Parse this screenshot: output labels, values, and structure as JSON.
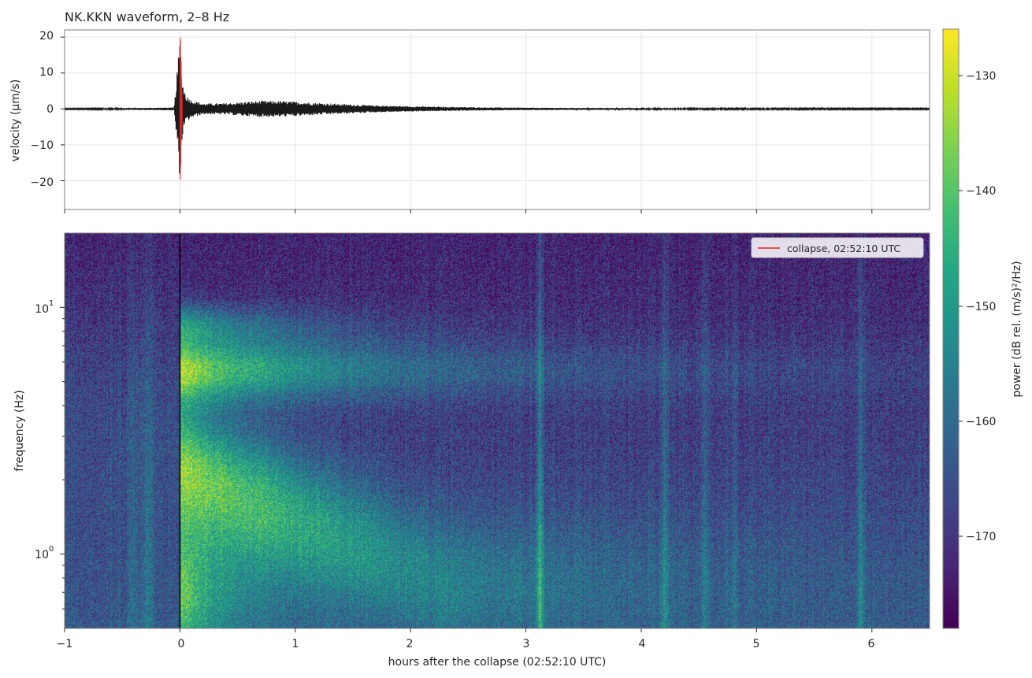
{
  "chart_data": [
    {
      "type": "line",
      "title": "NK.KKN waveform, 2–8 Hz",
      "ylabel": "velocity (µm/s)",
      "xlabel": "",
      "xlim": [
        -1,
        6.5
      ],
      "ylim": [
        -28,
        22
      ],
      "yticks": [
        20,
        10,
        0,
        -10,
        -20
      ],
      "ytick_labels": [
        "20",
        "10",
        "0",
        "−10",
        "−20"
      ],
      "grid": true,
      "series": [
        {
          "name": "",
          "color": "#1a1a1a",
          "envelope_x": [
            -1,
            -0.7,
            -0.3,
            -0.05,
            0.0,
            0.01,
            0.02,
            0.05,
            0.1,
            0.2,
            0.4,
            0.7,
            0.9,
            1.2,
            1.6,
            2.0,
            2.5,
            3.0,
            3.5,
            4.5,
            6.5
          ],
          "envelope_amp": [
            0.15,
            0.2,
            0.3,
            0.4,
            20,
            15,
            8,
            4,
            2.5,
            1.5,
            1.6,
            2.3,
            2.2,
            1.7,
            1.1,
            0.75,
            0.5,
            0.35,
            0.28,
            0.22,
            0.18
          ]
        },
        {
          "name": "",
          "color": "#d62728",
          "envelope_x": [
            0.0,
            0.005,
            0.012,
            0.02
          ],
          "envelope_amp": [
            25,
            19,
            10,
            3
          ]
        }
      ]
    },
    {
      "type": "heatmap",
      "title": "",
      "xlabel": "hours after the collapse (02:52:10 UTC)",
      "ylabel": "frequency (Hz)",
      "xlim": [
        -1,
        6.5
      ],
      "ylim": [
        0.5,
        20
      ],
      "yscale": "log",
      "xticks": [
        -1,
        0,
        1,
        2,
        3,
        4,
        5,
        6
      ],
      "xtick_labels": [
        "−1",
        "0",
        "1",
        "2",
        "3",
        "4",
        "5",
        "6"
      ],
      "yticks": [
        1,
        10
      ],
      "ytick_labels": [
        "10",
        "10"
      ],
      "ytick_exponents": [
        "0",
        "1"
      ],
      "colormap": "viridis",
      "colorbar": {
        "label": "power (dB rel. (m/s)²/Hz)",
        "range": [
          -178,
          -126
        ],
        "ticks": [
          -130,
          -140,
          -150,
          -160,
          -170
        ],
        "tick_labels": [
          "−130",
          "−140",
          "−150",
          "−160",
          "−170"
        ]
      },
      "legend": {
        "placement": "top-right",
        "entries": [
          {
            "label": "collapse, 02:52:10 UTC",
            "color": "#d62728"
          }
        ]
      },
      "event_marker": {
        "x": 0,
        "color": "#000000"
      }
    }
  ]
}
